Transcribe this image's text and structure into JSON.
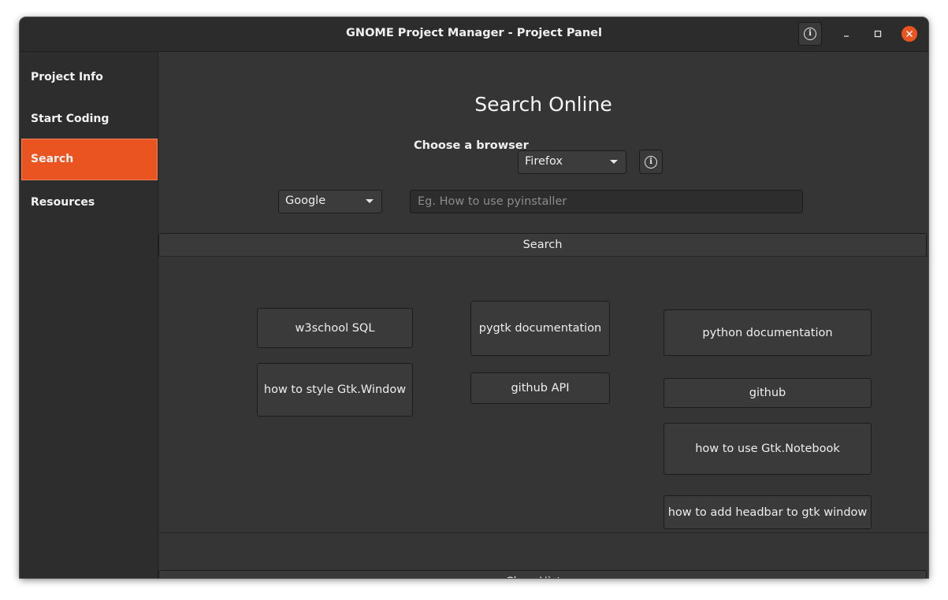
{
  "window": {
    "title": "GNOME Project Manager - Project Panel"
  },
  "sidebar": {
    "items": [
      {
        "label": "Project Info"
      },
      {
        "label": "Start Coding"
      },
      {
        "label": "Search"
      },
      {
        "label": "Resources"
      }
    ],
    "active": "Search"
  },
  "main": {
    "heading": "Search Online",
    "browser_label": "Choose a browser",
    "browser_selected": "Firefox",
    "engine_selected": "Google",
    "search_placeholder": "Eg. How to use pyinstaller",
    "search_value": "",
    "search_button": "Search",
    "clear_button": "Clear History"
  },
  "history": [
    "w3school SQL",
    "pygtk documentation",
    "python documentation",
    "how to style Gtk.Window",
    "github API",
    "github",
    "how to use Gtk.Notebook",
    "how to add headbar to gtk window"
  ],
  "colors": {
    "accent": "#e95420",
    "window_bg": "#353535",
    "sidebar_bg": "#2d2d2d"
  }
}
